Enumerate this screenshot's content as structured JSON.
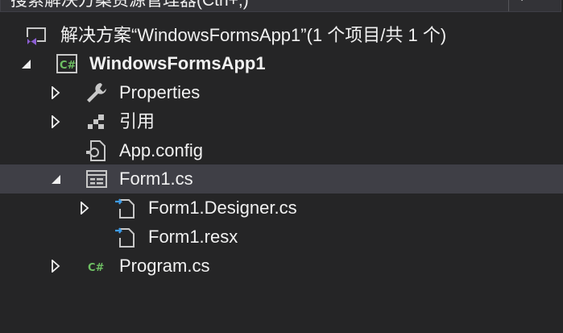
{
  "search": {
    "placeholder": "搜索解决方案资源管理器(Ctrl+;)"
  },
  "tree": {
    "solution_label": "解决方案“WindowsFormsApp1”(1 个项目/共 1 个)",
    "project_label": "WindowsFormsApp1",
    "items": {
      "properties": "Properties",
      "references": "引用",
      "app_config": "App.config",
      "form1": "Form1.cs",
      "form1_designer": "Form1.Designer.cs",
      "form1_resx": "Form1.resx",
      "program": "Program.cs"
    },
    "selected": "Form1.cs"
  },
  "colors": {
    "background": "#252526",
    "selection": "#3f3f46",
    "csharp_green": "#6ebf63",
    "vs_purple": "#8d5fd3",
    "link_blue": "#3e9ce8"
  },
  "icons": {
    "solution": "visual-studio-icon",
    "project": "csharp-project-icon",
    "properties": "wrench-icon",
    "references": "references-icon",
    "config": "config-file-icon",
    "form": "form-icon",
    "designer": "dependent-file-icon",
    "resx": "dependent-file-icon",
    "program": "csharp-file-icon",
    "search": "search-icon"
  }
}
